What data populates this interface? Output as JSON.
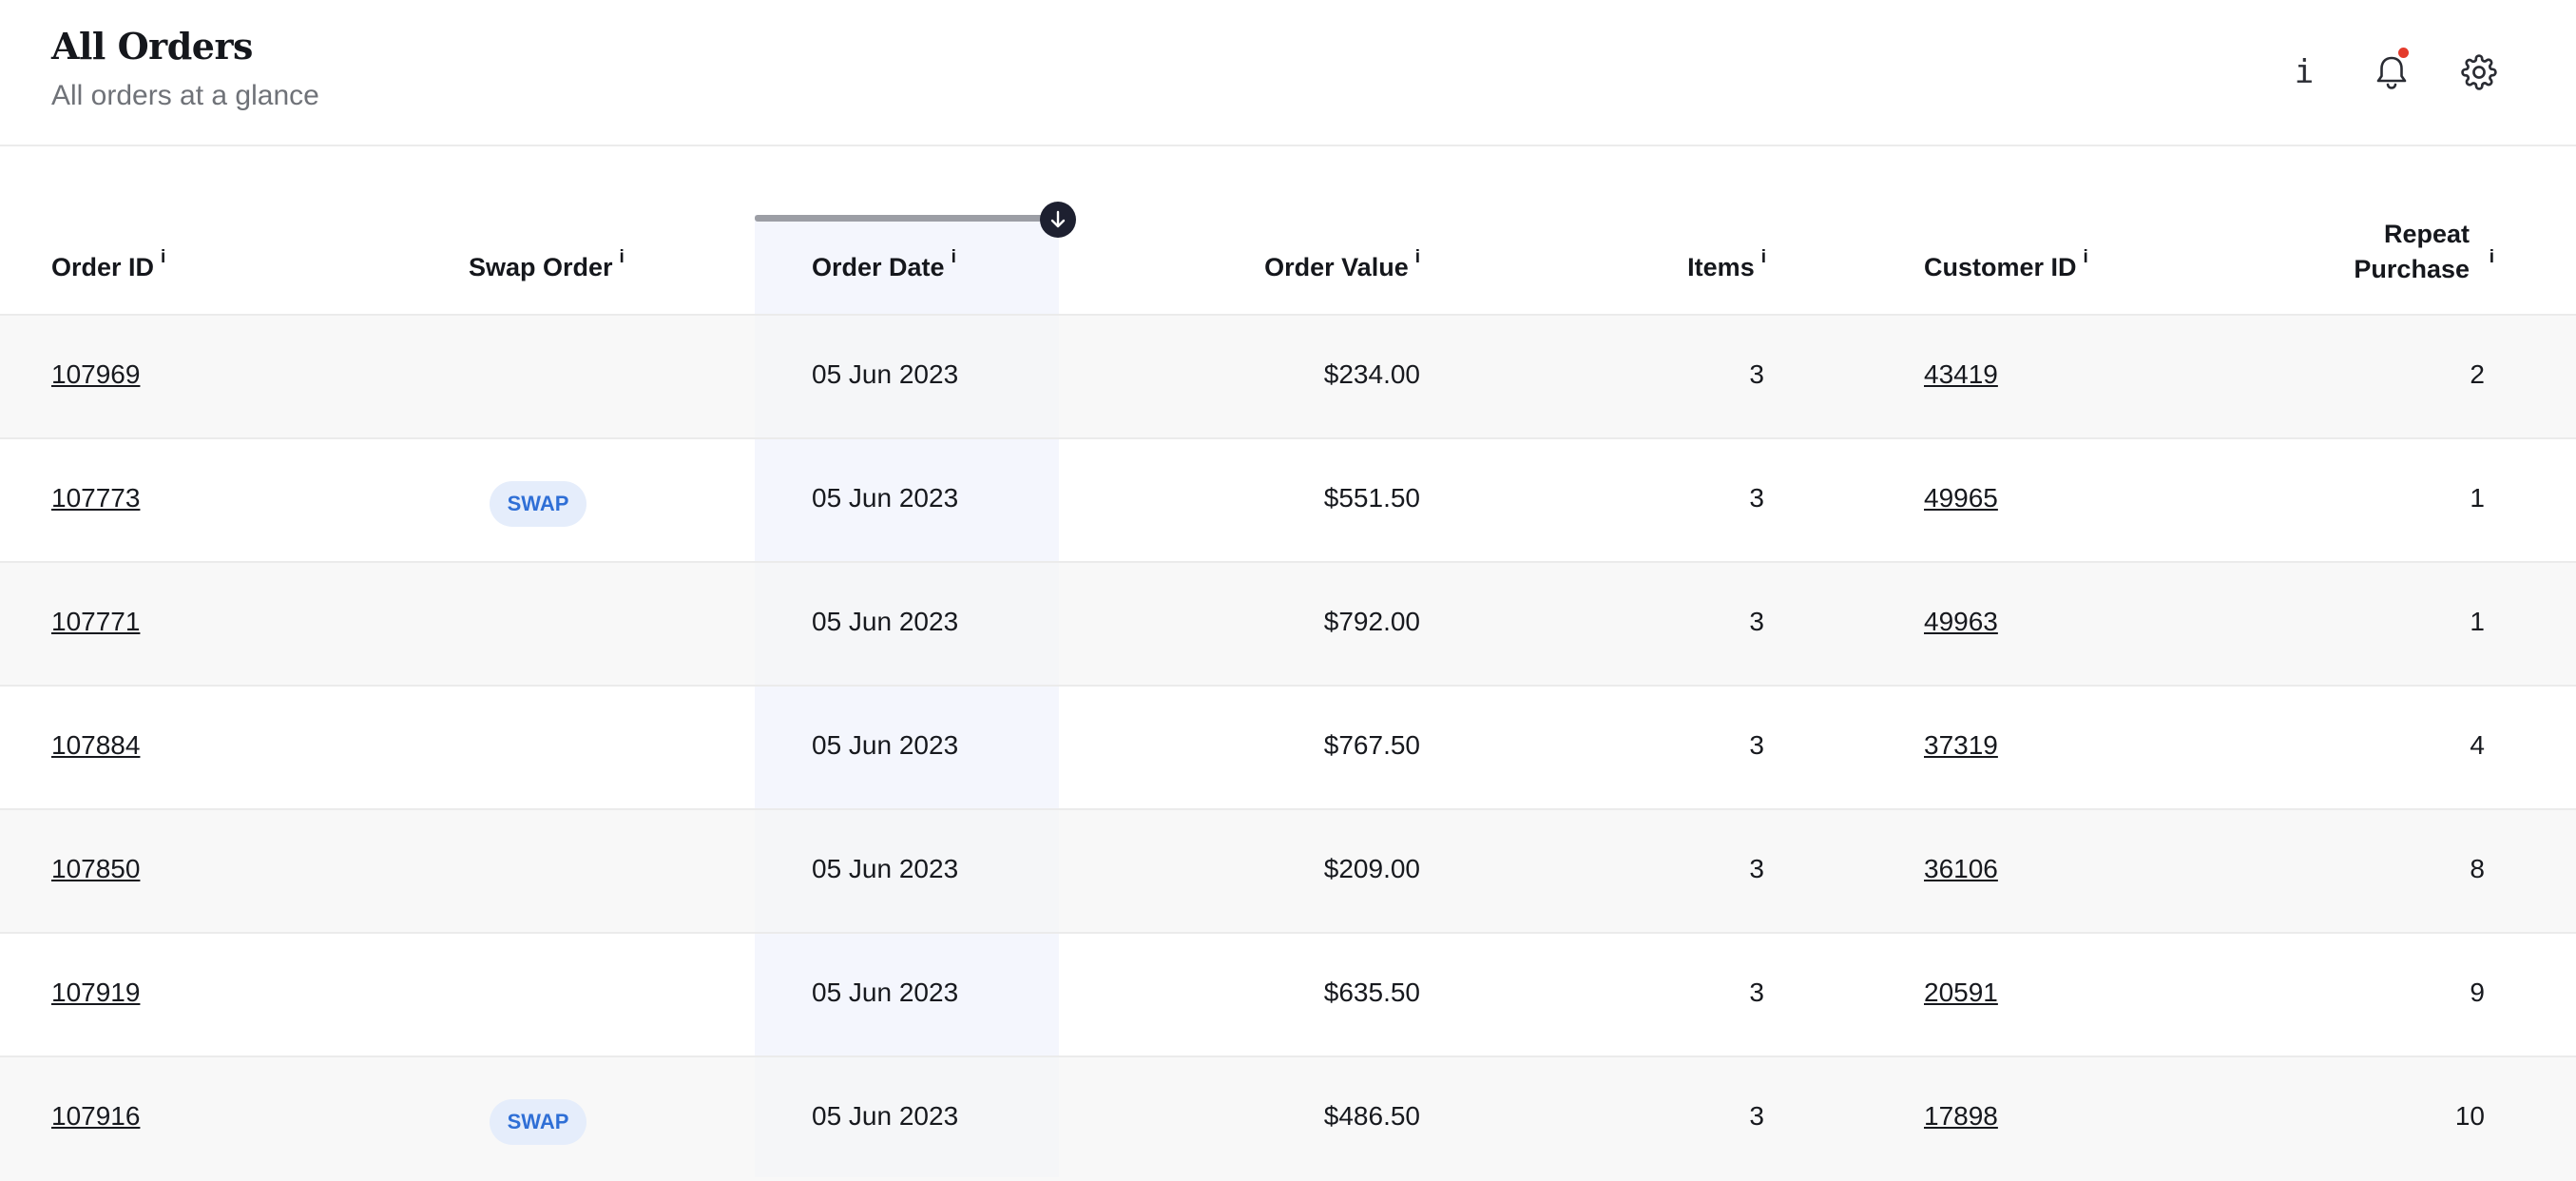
{
  "header": {
    "title": "All Orders",
    "subtitle": "All orders at a glance",
    "info_icon_glyph": "i"
  },
  "icons": [
    "info-icon",
    "bell-icon",
    "gear-icon",
    "sort-descending-icon"
  ],
  "colors": {
    "accent": "#2f6fd6",
    "notification_dot": "#e43b2c",
    "sorted_column_bg": "#f4f6fd",
    "sort_handle": "#1d2030"
  },
  "table": {
    "columns": {
      "order_id": "Order ID",
      "swap_order": "Swap Order",
      "order_date": "Order Date",
      "order_value": "Order Value",
      "items": "Items",
      "customer_id": "Customer ID",
      "repeat_line1": "Repeat",
      "repeat_line2": "Purchase"
    },
    "info_marker": "i",
    "sorted_by": "Order Date",
    "sort_direction": "descending",
    "rows": [
      {
        "order_id": "107969",
        "swap": "",
        "date": "05 Jun 2023",
        "value": "$234.00",
        "items": "3",
        "customer_id": "43419",
        "repeat": "2"
      },
      {
        "order_id": "107773",
        "swap": "SWAP",
        "date": "05 Jun 2023",
        "value": "$551.50",
        "items": "3",
        "customer_id": "49965",
        "repeat": "1"
      },
      {
        "order_id": "107771",
        "swap": "",
        "date": "05 Jun 2023",
        "value": "$792.00",
        "items": "3",
        "customer_id": "49963",
        "repeat": "1"
      },
      {
        "order_id": "107884",
        "swap": "",
        "date": "05 Jun 2023",
        "value": "$767.50",
        "items": "3",
        "customer_id": "37319",
        "repeat": "4"
      },
      {
        "order_id": "107850",
        "swap": "",
        "date": "05 Jun 2023",
        "value": "$209.00",
        "items": "3",
        "customer_id": "36106",
        "repeat": "8"
      },
      {
        "order_id": "107919",
        "swap": "",
        "date": "05 Jun 2023",
        "value": "$635.50",
        "items": "3",
        "customer_id": "20591",
        "repeat": "9"
      },
      {
        "order_id": "107916",
        "swap": "SWAP",
        "date": "05 Jun 2023",
        "value": "$486.50",
        "items": "3",
        "customer_id": "17898",
        "repeat": "10"
      }
    ]
  }
}
